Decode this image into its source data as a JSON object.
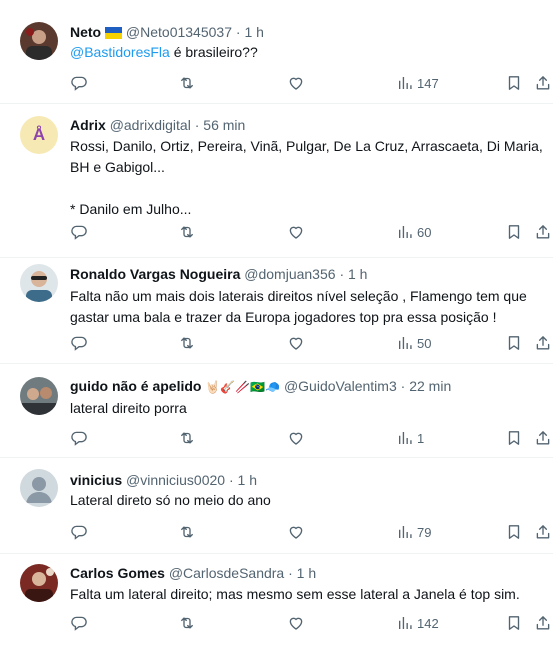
{
  "tweets": [
    {
      "name": "Neto",
      "name_emoji": "ukraine-flag",
      "handle": "@Neto01345037",
      "dot": "·",
      "time": "1 h",
      "mention": "@BastidoresFla",
      "text": " é brasileiro??",
      "views": "147"
    },
    {
      "name": "Adrix",
      "handle": "@adrixdigital",
      "dot": "·",
      "time": "56 min",
      "avatar_letter": "Å",
      "text_line1": "Rossi, Danilo, Ortiz, Pereira, Vinã, Pulgar, De La Cruz, Arrascaeta, Di Maria,",
      "text_line2": "BH e Gabigol...",
      "text_line3": "* Danilo em Julho...",
      "views": "60"
    },
    {
      "name": "Ronaldo Vargas Nogueira",
      "handle": "@domjuan356",
      "dot": "·",
      "time": "1 h",
      "text_line1": "Falta não um mais dois laterais direitos nível seleção , Flamengo tem que",
      "text_line2": "gastar uma bala e trazer da Europa jogadores top pra essa posição !",
      "views": "50"
    },
    {
      "name": "guido não é apelido",
      "name_emojis": "🤘🏻🎸🥢🇧🇷🧢",
      "handle": "@GuidoValentim3",
      "dot": "·",
      "time": "22 min",
      "text": "lateral direito porra",
      "views": "1"
    },
    {
      "name": "vinicius",
      "handle": "@vinnicius0020",
      "dot": "·",
      "time": "1 h",
      "text": "Lateral direto só no meio do ano",
      "views": "79"
    },
    {
      "name": "Carlos Gomes",
      "handle": "@CarlosdeSandra",
      "dot": "·",
      "time": "1 h",
      "text": "Falta um lateral direito; mas mesmo sem esse lateral a Janela é top sim.",
      "views": "142"
    }
  ],
  "icons": {
    "reply": "reply-icon",
    "retweet": "retweet-icon",
    "like": "like-icon",
    "views": "views-icon",
    "bookmark": "bookmark-icon",
    "share": "share-icon"
  },
  "colors": {
    "text": "#0f1419",
    "secondary": "#536471",
    "mention": "#1d9bf0",
    "divider": "#eff3f4",
    "avatar_letter_bg": "#f7e9b3",
    "avatar_letter_fg": "#8e44ad"
  }
}
